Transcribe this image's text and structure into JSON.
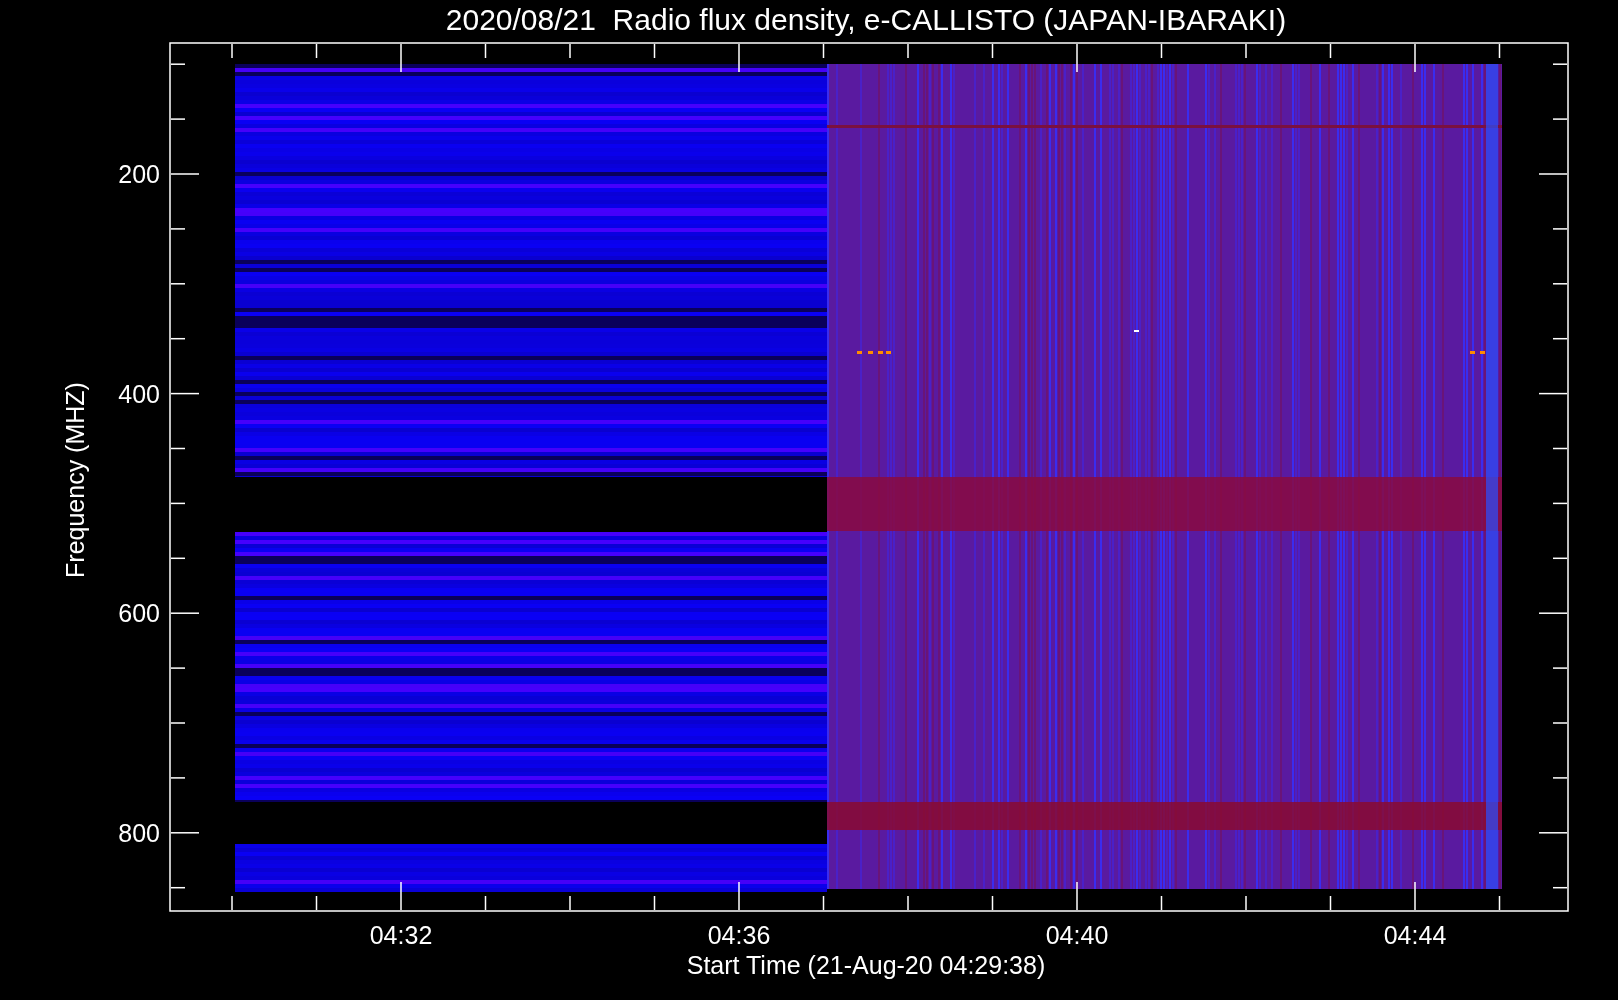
{
  "title": "2020/08/21  Radio flux density, e-CALLISTO (JAPAN-IBARAKI)",
  "y_axis": {
    "label": "Frequency (MHZ)",
    "ticks": [
      "200",
      "400",
      "600",
      "800"
    ]
  },
  "x_axis": {
    "label": "Start Time (21-Aug-20 04:29:38)",
    "ticks": [
      "04:32",
      "04:36",
      "04:40",
      "04:44"
    ]
  }
}
